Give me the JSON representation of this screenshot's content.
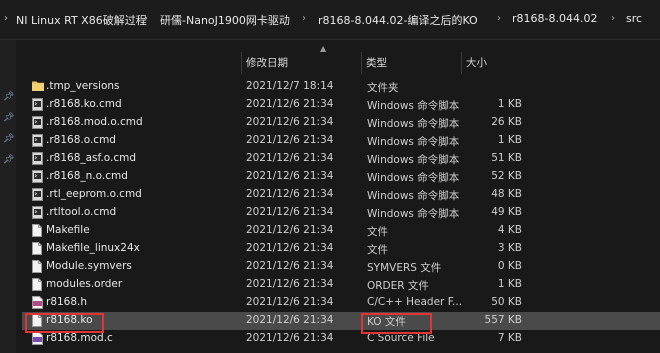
{
  "breadcrumbs": [
    "NI Linux RT X86破解过程",
    "研儒-NanoJ1900网卡驱动",
    "r8168-8.044.02-编译之后的KO",
    "r8168-8.044.02",
    "src"
  ],
  "columns": {
    "name": "",
    "modified": "修改日期",
    "type": "类型",
    "size": "大小"
  },
  "files": [
    {
      "name": ".tmp_versions",
      "modified": "2021/12/7 18:14",
      "type": "文件夹",
      "size": "",
      "icon": "folder-icon"
    },
    {
      "name": ".r8168.ko.cmd",
      "modified": "2021/12/6 21:34",
      "type": "Windows 命令脚本",
      "size": "1 KB",
      "icon": "cmd-file-icon"
    },
    {
      "name": ".r8168.mod.o.cmd",
      "modified": "2021/12/6 21:34",
      "type": "Windows 命令脚本",
      "size": "26 KB",
      "icon": "cmd-file-icon"
    },
    {
      "name": ".r8168.o.cmd",
      "modified": "2021/12/6 21:34",
      "type": "Windows 命令脚本",
      "size": "1 KB",
      "icon": "cmd-file-icon"
    },
    {
      "name": ".r8168_asf.o.cmd",
      "modified": "2021/12/6 21:34",
      "type": "Windows 命令脚本",
      "size": "51 KB",
      "icon": "cmd-file-icon"
    },
    {
      "name": ".r8168_n.o.cmd",
      "modified": "2021/12/6 21:34",
      "type": "Windows 命令脚本",
      "size": "52 KB",
      "icon": "cmd-file-icon"
    },
    {
      "name": ".rtl_eeprom.o.cmd",
      "modified": "2021/12/6 21:34",
      "type": "Windows 命令脚本",
      "size": "48 KB",
      "icon": "cmd-file-icon"
    },
    {
      "name": ".rtltool.o.cmd",
      "modified": "2021/12/6 21:34",
      "type": "Windows 命令脚本",
      "size": "49 KB",
      "icon": "cmd-file-icon"
    },
    {
      "name": "Makefile",
      "modified": "2021/12/6 21:34",
      "type": "文件",
      "size": "4 KB",
      "icon": "blank-file-icon"
    },
    {
      "name": "Makefile_linux24x",
      "modified": "2021/12/6 21:34",
      "type": "文件",
      "size": "3 KB",
      "icon": "blank-file-icon"
    },
    {
      "name": "Module.symvers",
      "modified": "2021/12/6 21:34",
      "type": "SYMVERS 文件",
      "size": "0 KB",
      "icon": "blank-file-icon"
    },
    {
      "name": "modules.order",
      "modified": "2021/12/6 21:34",
      "type": "ORDER 文件",
      "size": "1 KB",
      "icon": "blank-file-icon"
    },
    {
      "name": "r8168.h",
      "modified": "2021/12/6 21:34",
      "type": "C/C++ Header F...",
      "size": "50 KB",
      "icon": "header-file-icon"
    },
    {
      "name": "r8168.ko",
      "modified": "2021/12/6 21:34",
      "type": "KO 文件",
      "size": "557 KB",
      "icon": "blank-file-icon",
      "selected": true
    },
    {
      "name": "r8168.mod.c",
      "modified": "2021/12/6 21:34",
      "type": "C Source File",
      "size": "7 KB",
      "icon": "c-file-icon"
    }
  ],
  "colors": {
    "highlight": "#e03535",
    "selected_row": "#4a4a4a",
    "folder": "#e8c25a"
  }
}
